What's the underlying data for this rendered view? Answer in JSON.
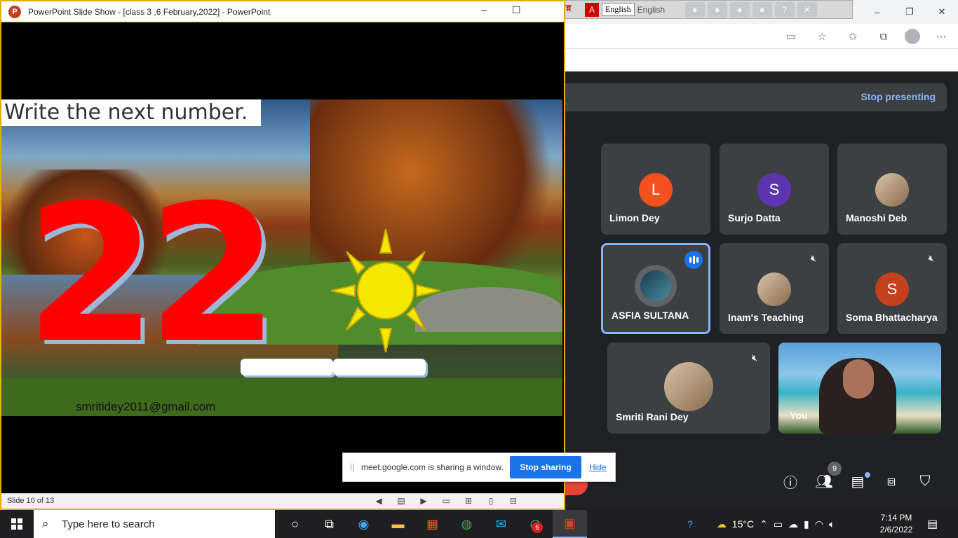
{
  "ppt": {
    "title": "PowerPoint Slide Show - [class 3 ,6 February,2022] - PowerPoint",
    "minimize": "–",
    "restore": "☐",
    "slide_text": "Write the next number.",
    "big_number": "22",
    "email": "smritidey2011@gmail.com",
    "status": "Slide 10 of 13"
  },
  "lang_bar": {
    "bangla": "বিজয় বায়ান্ন",
    "english": "English",
    "english2": "English"
  },
  "browser": {
    "minimize": "–",
    "restore": "❐",
    "close": "✕"
  },
  "meet": {
    "stop_presenting": "Stop presenting",
    "participants_count": "9",
    "tiles": [
      {
        "name": "Limon Dey",
        "initial": "L",
        "color": "#f4511e"
      },
      {
        "name": "Surjo Datta",
        "initial": "S",
        "color": "#5e35b1"
      },
      {
        "name": "Manoshi Deb"
      },
      {
        "name": "ASFIA SULTANA"
      },
      {
        "name": "Inam's Teaching"
      },
      {
        "name": "Soma Bhattacharya",
        "initial": "S",
        "color": "#c5401c"
      },
      {
        "name": "Smriti Rani Dey"
      },
      {
        "name": "You"
      }
    ]
  },
  "share_banner": {
    "message": "meet.google.com is sharing a window.",
    "stop": "Stop sharing",
    "hide": "Hide"
  },
  "taskbar": {
    "search_placeholder": "Type here to search",
    "whatsapp_badge": "6",
    "temperature": "15°C",
    "time": "7:14 PM",
    "date": "2/6/2022"
  }
}
